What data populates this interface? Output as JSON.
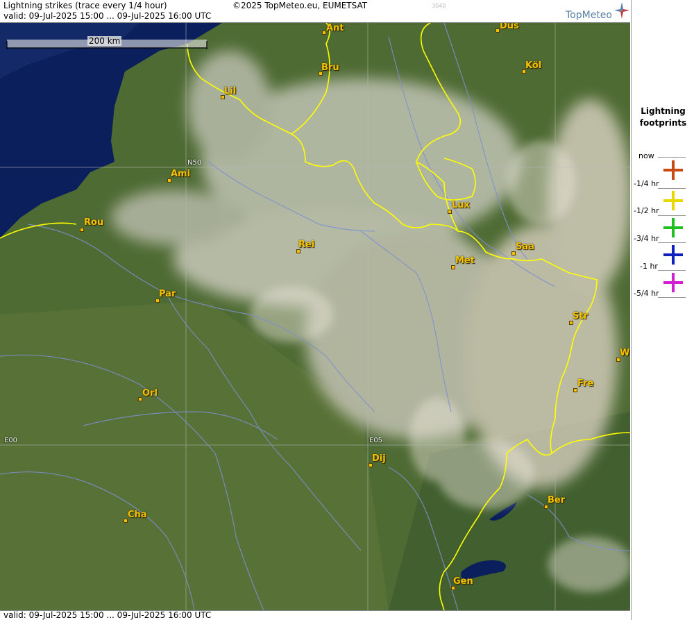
{
  "header": {
    "title": "Lightning strikes (trace every 1/4 hour)",
    "valid": "valid:  09-Jul-2025 15:00 ... 09-Jul-2025 16:00 UTC",
    "copyright": "©2025 TopMeteo.eu, EUMETSAT",
    "code": "3040",
    "brand": "TopMeteo"
  },
  "footer": {
    "valid": "valid:  09-Jul-2025 15:00 ... 09-Jul-2025 16:00 UTC"
  },
  "map": {
    "scale_label": "200 km",
    "grid_labels": {
      "lat_n50": "N50",
      "lon_e00": "E00",
      "lon_e05": "E05"
    },
    "cities": [
      {
        "label": "Ant"
      },
      {
        "label": "Düs"
      },
      {
        "label": "Bru"
      },
      {
        "label": "Köl"
      },
      {
        "label": "Lil"
      },
      {
        "label": "Ami"
      },
      {
        "label": "Lux"
      },
      {
        "label": "Rou"
      },
      {
        "label": "Rei"
      },
      {
        "label": "Saa"
      },
      {
        "label": "Met"
      },
      {
        "label": "Par"
      },
      {
        "label": "Str"
      },
      {
        "label": "W"
      },
      {
        "label": "Fre"
      },
      {
        "label": "Orl"
      },
      {
        "label": "Dij"
      },
      {
        "label": "Ber"
      },
      {
        "label": "Cha"
      },
      {
        "label": "Gen"
      }
    ]
  },
  "legend": {
    "title_line1": "Lightning",
    "title_line2": "footprints",
    "items": [
      {
        "label": "now",
        "color": "#c84a10"
      },
      {
        "label": "-1/4 hr",
        "color": "#e8d800"
      },
      {
        "label": "-1/2 hr",
        "color": "#20c020"
      },
      {
        "label": "-3/4 hr",
        "color": "#1020c0"
      },
      {
        "label": "-1 hr",
        "color": "#d020d0"
      },
      {
        "label": "-5/4 hr",
        "color": ""
      }
    ]
  },
  "colors": {
    "sea": "#0b1f5c",
    "land": "#4f6b34",
    "border": "#ffff00",
    "river": "#7f8fd0",
    "city": "#f2c200"
  }
}
